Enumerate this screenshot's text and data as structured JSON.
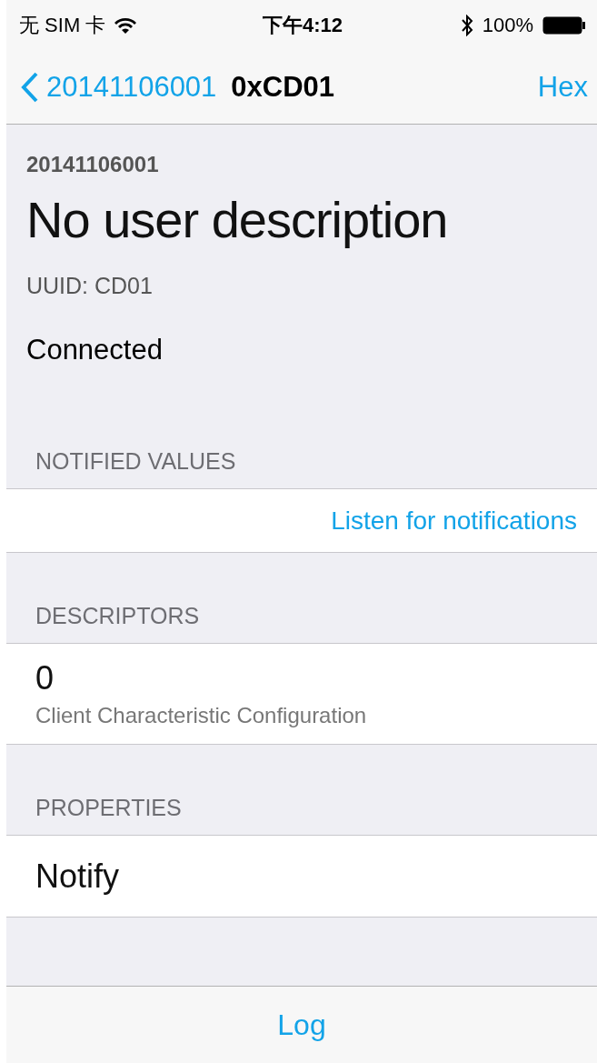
{
  "status_bar": {
    "carrier": "无 SIM 卡",
    "time": "下午4:12",
    "battery": "100%"
  },
  "nav": {
    "back": "20141106001",
    "title": "0xCD01",
    "action": "Hex"
  },
  "header": {
    "device": "20141106001",
    "description": "No user description",
    "uuid": "UUID: CD01",
    "state": "Connected"
  },
  "sections": [
    {
      "title": "NOTIFIED VALUES",
      "kind": "action",
      "action": "Listen for notifications"
    },
    {
      "title": "DESCRIPTORS",
      "kind": "detail",
      "value": "0",
      "subtitle": "Client Characteristic Configuration"
    },
    {
      "title": "PROPERTIES",
      "kind": "plain",
      "value": "Notify"
    }
  ],
  "toolbar": {
    "button": "Log"
  }
}
